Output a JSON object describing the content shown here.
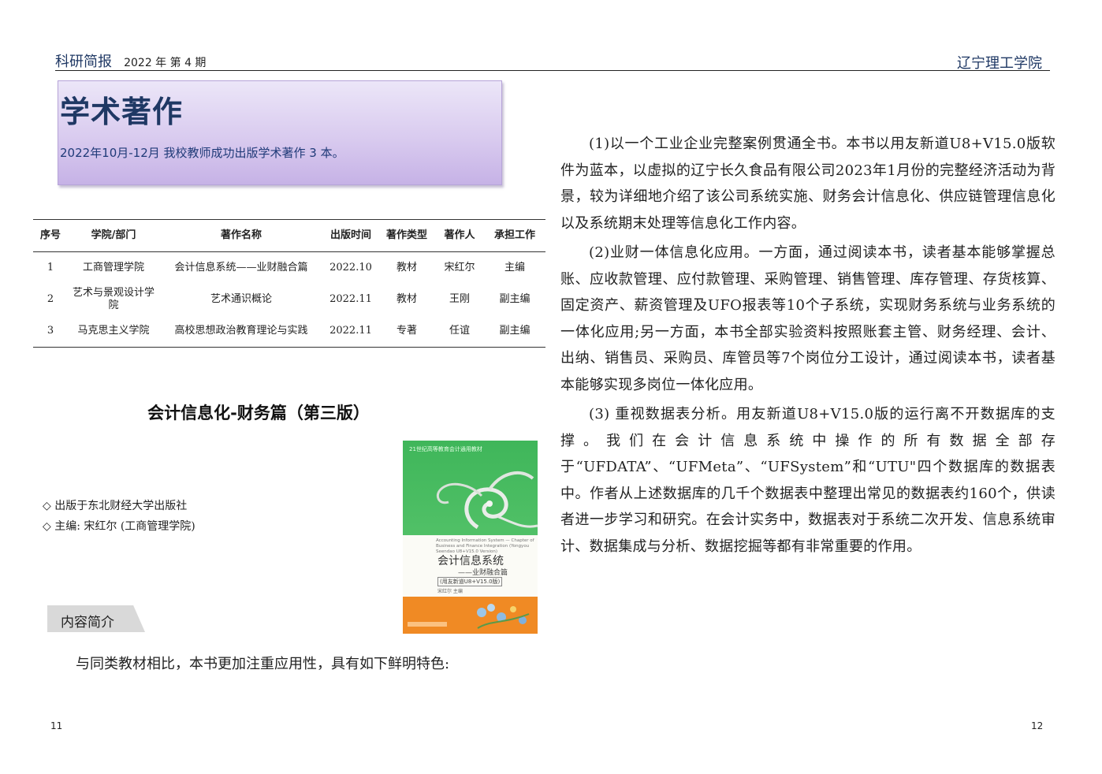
{
  "header": {
    "brand": "科研简报",
    "issue": "2022 年 第 4 期",
    "institution": "辽宁理工学院"
  },
  "section": {
    "title": "学术著作",
    "subtitle": "2022年10月-12月 我校教师成功出版学术著作 3 本。"
  },
  "table": {
    "headers": [
      "序号",
      "学院/部门",
      "著作名称",
      "出版时间",
      "著作类型",
      "著作人",
      "承担工作"
    ],
    "rows": [
      [
        "1",
        "工商管理学院",
        "会计信息系统——业财融合篇",
        "2022.10",
        "教材",
        "宋红尔",
        "主编"
      ],
      [
        "2",
        "艺术与景观设计学院",
        "艺术通识概论",
        "2022.11",
        "教材",
        "王刚",
        "副主编"
      ],
      [
        "3",
        "马克思主义学院",
        "高校思想政治教育理论与实践",
        "2022.11",
        "专著",
        "任谊",
        "副主编"
      ]
    ]
  },
  "book": {
    "title": "会计信息化-财务篇（第三版）",
    "publisher": "◇ 出版于东北财经大学出版社",
    "editor": "◇ 主编: 宋红尔 (工商管理学院)",
    "cover": {
      "series": "21世纪高等教育会计通用教材",
      "english": "Accounting Information System — Chapter of Business and Finance Integration (Yongyou Seendao U8+V15.0 Version)",
      "cn_title": "会计信息系统",
      "cn_subtitle": "——业财融合篇",
      "edition": "(用友新道U8+V15.0版)",
      "author": "宋红尔 主编"
    }
  },
  "intro": {
    "tag": "内容简介",
    "lead": "与同类教材相比，本书更加注重应用性，具有如下鲜明特色:"
  },
  "paragraphs": [
    "(1)以一个工业企业完整案例贯通全书。本书以用友新道U8+V15.0版软件为蓝本，以虚拟的辽宁长久食品有限公司2023年1月份的完整经济活动为背景，较为详细地介绍了该公司系统实施、财务会计信息化、供应链管理信息化以及系统期末处理等信息化工作内容。",
    "(2)业财一体信息化应用。一方面，通过阅读本书，读者基本能够掌握总账、应收款管理、应付款管理、采购管理、销售管理、库存管理、存货核算、固定资产、薪资管理及UFO报表等10个子系统，实现财务系统与业务系统的一体化应用;另一方面，本书全部实验资料按照账套主管、财务经理、会计、出纳、销售员、采购员、库管员等7个岗位分工设计，通过阅读本书，读者基本能够实现多岗位一体化应用。",
    "(3) 重视数据表分析。用友新道U8+V15.0版的运行离不开数据库的支撑。我们在会计信息系统中操作的所有数据全部存于“UFDATA”、“UFMeta”、“UFSystem”和“UTU\"四个数据库的数据表中。作者从上述数据库的几千个数据表中整理出常见的数据表约160个，供读者进一步学习和研究。在会计实务中，数据表对于系统二次开发、信息系统审计、数据集成与分析、数据挖掘等都有非常重要的作用。"
  ],
  "pages": {
    "left": "11",
    "right": "12"
  }
}
